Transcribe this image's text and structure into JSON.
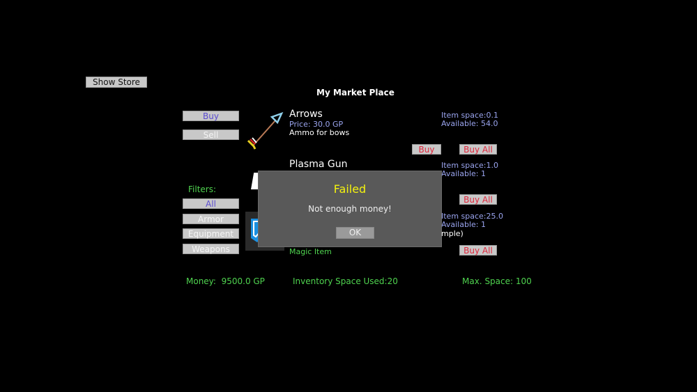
{
  "show_store_label": "Show Store",
  "market_title": "My Market Place",
  "mode_buttons": {
    "buy": "Buy",
    "sell": "Sell"
  },
  "filters": {
    "label": "Filters:",
    "options": [
      "All",
      "Armor",
      "Equipment",
      "Weapons"
    ],
    "selected": "All"
  },
  "items": [
    {
      "name": "Arrows",
      "price": "Price: 30.0 GP",
      "description": "Ammo for bows",
      "item_space": "Item space:0.1",
      "available": "Available: 54.0",
      "icon": "arrow-icon",
      "buy_label": "Buy",
      "buy_all_label": "Buy All"
    },
    {
      "name": "Plasma Gun",
      "item_space": "Item space:1.0",
      "available": "Available: 1",
      "icon": "plasma-gun-icon",
      "buy_all_label": "Buy All"
    },
    {
      "description_partial": "mple)",
      "category": "Magic Item",
      "item_space": "Item space:25.0",
      "available": "Available: 1",
      "icon": "shield-icon",
      "buy_all_label": "Buy All"
    }
  ],
  "footer": {
    "money": "Money:  9500.0 GP",
    "inventory_used": "Inventory Space Used:20",
    "max_space": "Max. Space: 100"
  },
  "dialog": {
    "title": "Failed",
    "message": "Not enough money!",
    "ok_label": "OK"
  }
}
